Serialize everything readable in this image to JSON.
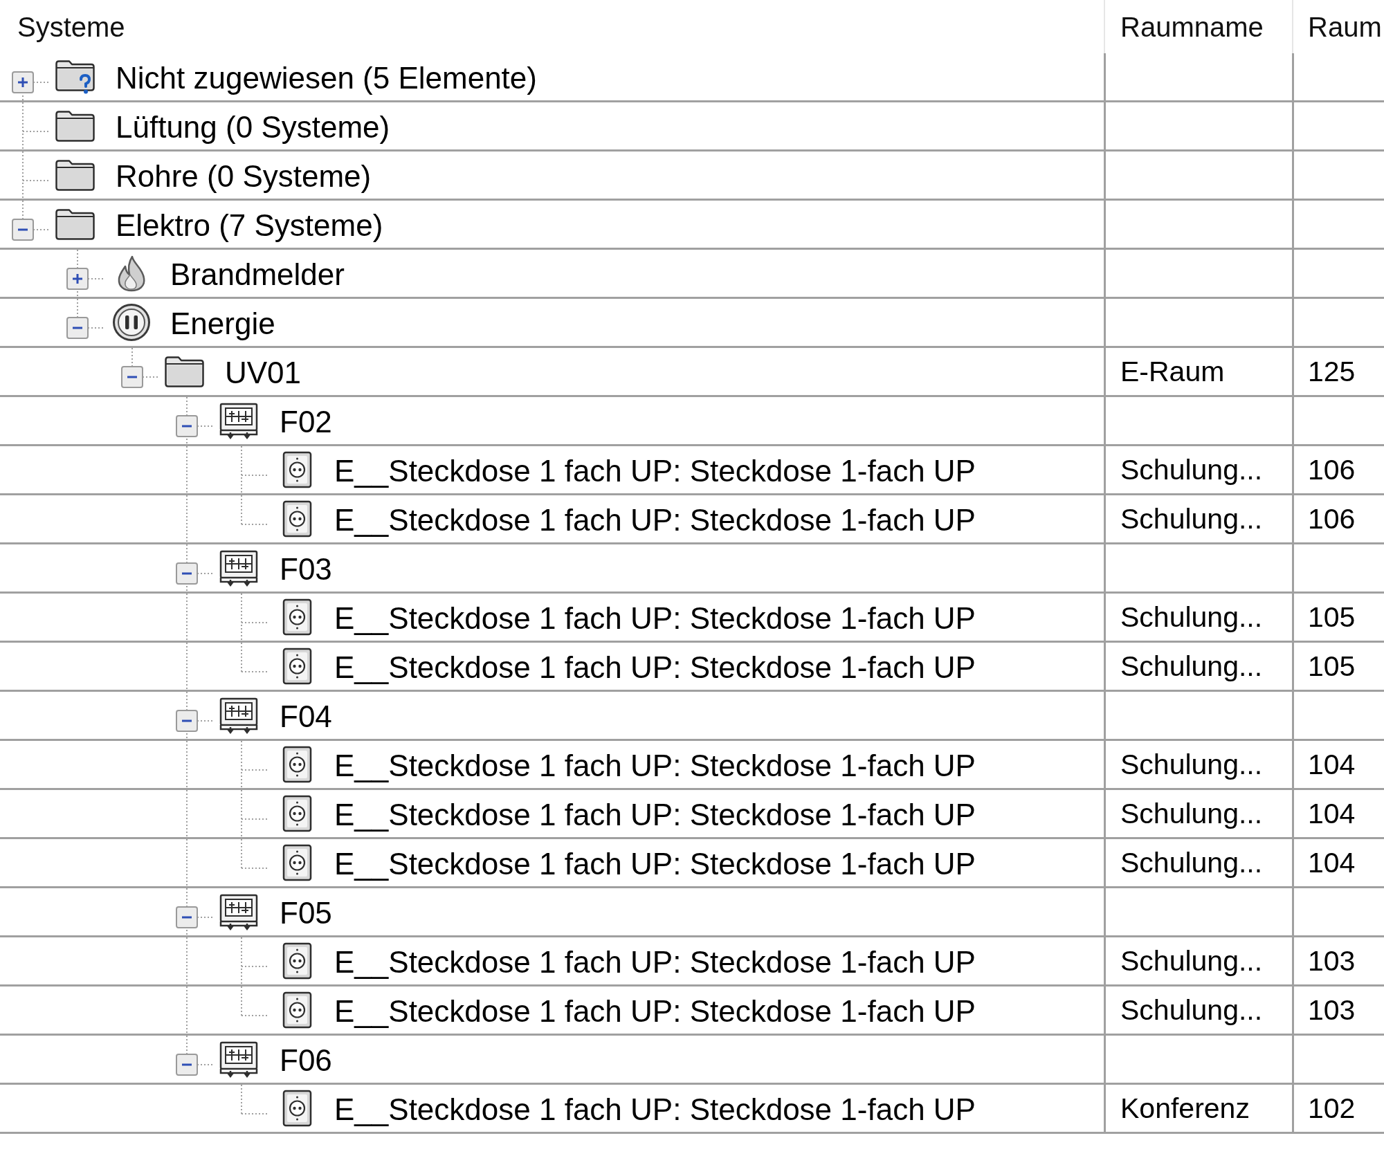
{
  "tree_table": {
    "columns": [
      "Systeme",
      "Raumname",
      "Raum"
    ],
    "rows": [
      {
        "label": "Nicht zugewiesen (5 Elemente)",
        "kind": "unassigned",
        "expanded": false
      },
      {
        "label": "Lüftung (0 Systeme)",
        "kind": "folder"
      },
      {
        "label": "Rohre (0 Systeme)",
        "kind": "folder"
      },
      {
        "label": "Elektro (7 Systeme)",
        "kind": "folder",
        "expanded": true,
        "children": [
          {
            "label": "Brandmelder",
            "kind": "fire_alarm",
            "expanded": false
          },
          {
            "label": "Energie",
            "kind": "power",
            "expanded": true,
            "children": [
              {
                "label": "UV01",
                "kind": "folder",
                "expanded": true,
                "cells": [
                  "E-Raum",
                  "125"
                ],
                "children": [
                  {
                    "label": "F02",
                    "kind": "circuit",
                    "expanded": true,
                    "children": [
                      {
                        "label": "E__Steckdose 1 fach UP: Steckdose 1-fach UP",
                        "kind": "socket",
                        "cells": [
                          "Schulung...",
                          "106"
                        ]
                      },
                      {
                        "label": "E__Steckdose 1 fach UP: Steckdose 1-fach UP",
                        "kind": "socket",
                        "cells": [
                          "Schulung...",
                          "106"
                        ]
                      }
                    ]
                  },
                  {
                    "label": "F03",
                    "kind": "circuit",
                    "expanded": true,
                    "children": [
                      {
                        "label": "E__Steckdose 1 fach UP: Steckdose 1-fach UP",
                        "kind": "socket",
                        "cells": [
                          "Schulung...",
                          "105"
                        ]
                      },
                      {
                        "label": "E__Steckdose 1 fach UP: Steckdose 1-fach UP",
                        "kind": "socket",
                        "cells": [
                          "Schulung...",
                          "105"
                        ]
                      }
                    ]
                  },
                  {
                    "label": "F04",
                    "kind": "circuit",
                    "expanded": true,
                    "children": [
                      {
                        "label": "E__Steckdose 1 fach UP: Steckdose 1-fach UP",
                        "kind": "socket",
                        "cells": [
                          "Schulung...",
                          "104"
                        ]
                      },
                      {
                        "label": "E__Steckdose 1 fach UP: Steckdose 1-fach UP",
                        "kind": "socket",
                        "cells": [
                          "Schulung...",
                          "104"
                        ]
                      },
                      {
                        "label": "E__Steckdose 1 fach UP: Steckdose 1-fach UP",
                        "kind": "socket",
                        "cells": [
                          "Schulung...",
                          "104"
                        ]
                      }
                    ]
                  },
                  {
                    "label": "F05",
                    "kind": "circuit",
                    "expanded": true,
                    "children": [
                      {
                        "label": "E__Steckdose 1 fach UP: Steckdose 1-fach UP",
                        "kind": "socket",
                        "cells": [
                          "Schulung...",
                          "103"
                        ]
                      },
                      {
                        "label": "E__Steckdose 1 fach UP: Steckdose 1-fach UP",
                        "kind": "socket",
                        "cells": [
                          "Schulung...",
                          "103"
                        ]
                      }
                    ]
                  },
                  {
                    "label": "F06",
                    "kind": "circuit",
                    "expanded": true,
                    "children": [
                      {
                        "label": "E__Steckdose 1 fach UP: Steckdose 1-fach UP",
                        "kind": "socket",
                        "cells": [
                          "Konferenz",
                          "102"
                        ]
                      }
                    ]
                  }
                ]
              }
            ]
          }
        ]
      }
    ]
  }
}
